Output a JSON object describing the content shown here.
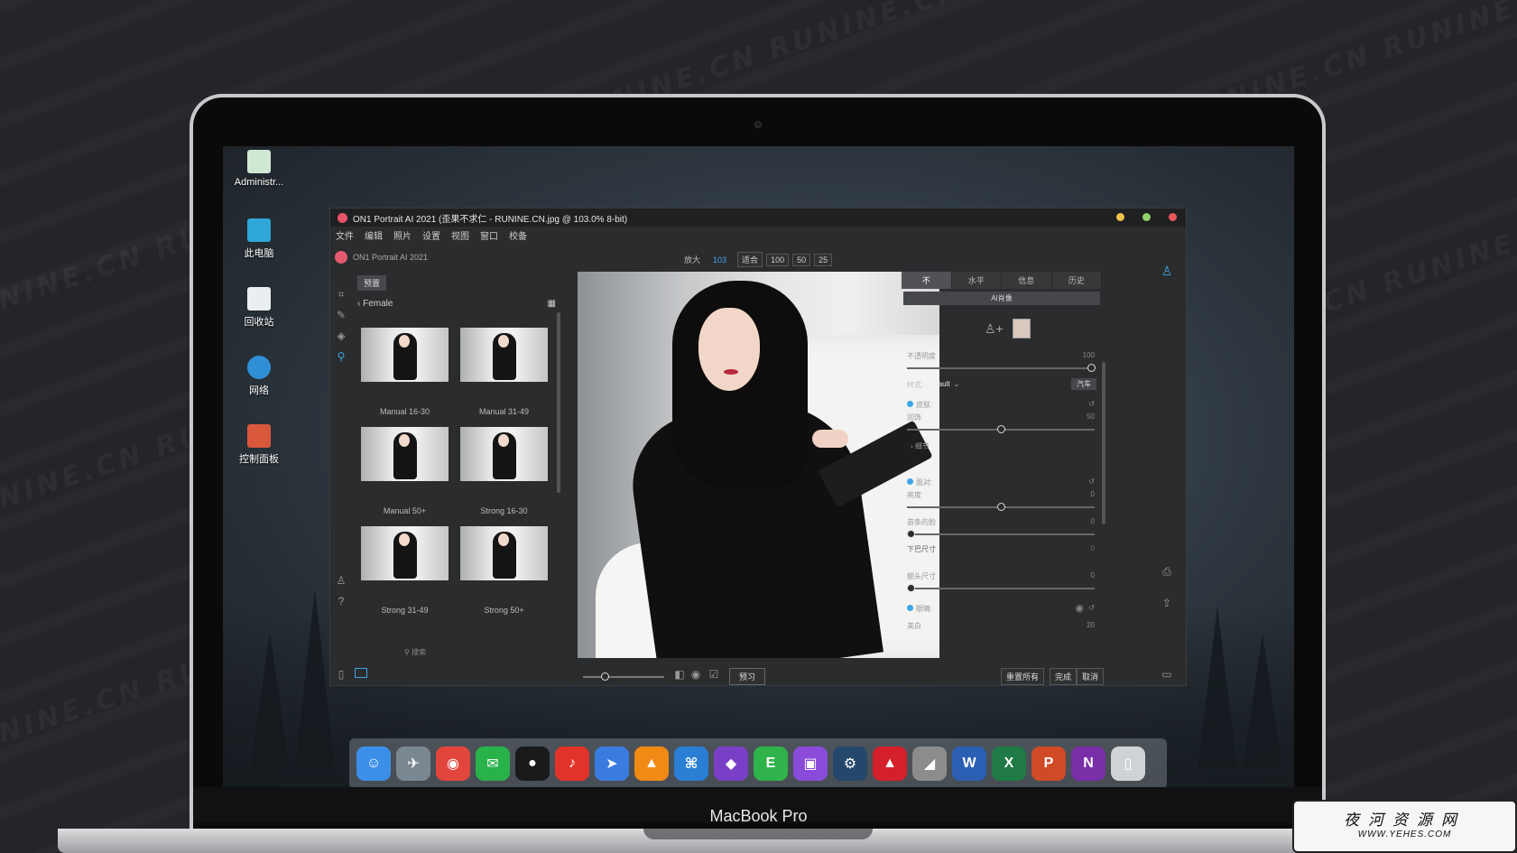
{
  "desktop": {
    "icons": [
      {
        "label": "Administr..."
      },
      {
        "label": "此电脑"
      },
      {
        "label": "回收站"
      },
      {
        "label": "网络"
      },
      {
        "label": "控制面板"
      }
    ]
  },
  "laptop": {
    "label": "MacBook Pro"
  },
  "app": {
    "title": "ON1 Portrait AI 2021 (歪果不求仁 - RUNINE.CN.jpg @ 103.0% 8-bit)",
    "menu": [
      "文件",
      "编辑",
      "照片",
      "设置",
      "视图",
      "窗口",
      "校备"
    ],
    "app_name": "ON1 Portrait AI 2021",
    "zoom": {
      "label": "放大",
      "value": "103",
      "buttons": [
        "适合",
        "100",
        "50",
        "25"
      ]
    },
    "preset_tab": "预置",
    "breadcrumb": "Female",
    "presets": [
      {
        "label": "Manual 16-30"
      },
      {
        "label": "Manual 31-49"
      },
      {
        "label": "Manual 50+"
      },
      {
        "label": "Strong 16-30"
      },
      {
        "label": "Strong 31-49"
      },
      {
        "label": "Strong 50+"
      }
    ],
    "search_placeholder": "搜索",
    "right": {
      "tabs": [
        "不",
        "水平",
        "信息",
        "历史"
      ],
      "ai_bar": "AI肖像",
      "opacity_label": "不透明度",
      "opacity_value": "100",
      "opacity_level": 1.0,
      "style_label": "样式:",
      "style_value": "Default",
      "auto_label": "汽车",
      "skin_label": "皮肤:",
      "smooth_label": "润饰",
      "smooth_value": "50",
      "smooth_level": 0.5,
      "detail_label": "细节",
      "face_label": "面对:",
      "bright_label": "亮度",
      "bright_value": "0",
      "bright_level": 0.5,
      "slim_label": "苗条的脸",
      "slim_value": "0",
      "slim_level": 0.0,
      "chin_label": "下巴尺寸",
      "chin_value": "0",
      "forehead_label": "额头尺寸",
      "forehead_value": "0",
      "forehead_level": 0.0,
      "eyes_label": "眼睛:",
      "white_label": "美白",
      "white_value": "20"
    },
    "bottom": {
      "preview": "预习",
      "reset_all": "重置所有",
      "done": "完成",
      "cancel": "取消"
    }
  },
  "dock": {
    "apps": [
      {
        "icon": "finder-icon",
        "color": "#3c8fe8",
        "glyph": "☺"
      },
      {
        "icon": "launchpad-icon",
        "color": "#7b8790",
        "glyph": "✈"
      },
      {
        "icon": "chrome-icon",
        "color": "#e2453c",
        "glyph": "◉"
      },
      {
        "icon": "wechat-icon",
        "color": "#29b14a",
        "glyph": "✉"
      },
      {
        "icon": "qq-icon",
        "color": "#1a1a1a",
        "glyph": "●"
      },
      {
        "icon": "netease-music-icon",
        "color": "#e2332a",
        "glyph": "♪"
      },
      {
        "icon": "feishu-icon",
        "color": "#3a7be0",
        "glyph": "➤"
      },
      {
        "icon": "vlc-icon",
        "color": "#f08a14",
        "glyph": "▲"
      },
      {
        "icon": "vscode-icon",
        "color": "#2a7fd4",
        "glyph": "⌘"
      },
      {
        "icon": "github-icon",
        "color": "#7a3fc7",
        "glyph": "◆"
      },
      {
        "icon": "evernote-icon",
        "color": "#2fb34a",
        "glyph": "E"
      },
      {
        "icon": "twitch-icon",
        "color": "#8a4bdb",
        "glyph": "▣"
      },
      {
        "icon": "steam-icon",
        "color": "#24476b",
        "glyph": "⚙"
      },
      {
        "icon": "acrobat-icon",
        "color": "#d3202b",
        "glyph": "▲"
      },
      {
        "icon": "rhino-icon",
        "color": "#8c8c8c",
        "glyph": "◢"
      },
      {
        "icon": "word-icon",
        "color": "#2b5fb4",
        "glyph": "W"
      },
      {
        "icon": "excel-icon",
        "color": "#1f7a45",
        "glyph": "X"
      },
      {
        "icon": "powerpoint-icon",
        "color": "#d04a26",
        "glyph": "P"
      },
      {
        "icon": "onenote-icon",
        "color": "#7a2fa8",
        "glyph": "N"
      },
      {
        "icon": "trash-icon",
        "color": "#cfd3d6",
        "glyph": "▯"
      }
    ]
  },
  "badge": {
    "title": "夜河资源网",
    "url": "WWW.YEHES.COM"
  }
}
